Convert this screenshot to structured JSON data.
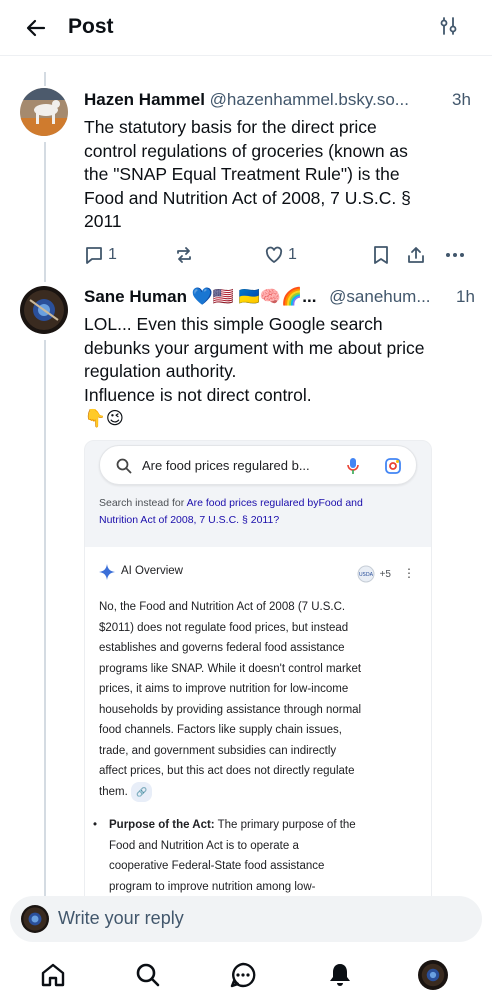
{
  "header": {
    "title": "Post",
    "back_icon": "arrow-left-icon",
    "sort_icon": "sliders-icon"
  },
  "post1": {
    "display_name": "Hazen Hammel",
    "handle": "@hazenhammel.bsky.so...",
    "time": "3h",
    "text_lines": [
      "The statutory basis for the direct price",
      "control regulations of groceries (known as",
      "the \"SNAP Equal Treatment Rule\") is the",
      "Food and Nutrition Act of 2008, 7 U.S.C. §",
      "2011"
    ],
    "reply_count": "1",
    "repost_count": "",
    "like_count": "1"
  },
  "post2": {
    "display_name": "Sane Human 💙🇺🇸 🇺🇦🧠🌈...",
    "handle": "@sanehum...",
    "time": "1h",
    "text_lines": [
      "LOL... Even this simple Google search",
      "debunks your argument with me about  price",
      "regulation authority.",
      "Influence is not direct control.",
      "👇😉"
    ]
  },
  "embed": {
    "search_query": "Are  food prices regulared b...",
    "search_instead_prefix": "Search instead for ",
    "search_instead_link_1": "Are food prices regulared byFood and",
    "search_instead_link_2": "Nutrition Act of 2008, 7 U.S.C. § 2011?",
    "ai_title": "AI Overview",
    "sources_count": "+5",
    "ai_body_lines": [
      "No, the Food and Nutrition Act of 2008 (7 U.S.C.",
      "$2011) does not regulate food prices, but instead",
      "establishes and governs federal food assistance",
      "programs like SNAP. While it doesn't control market",
      "prices, it aims to improve nutrition for low-income",
      "households by providing assistance through normal",
      "food channels. Factors like supply chain issues,",
      "trade, and government subsidies can indirectly",
      "affect prices, but this act does not directly regulate",
      "them."
    ],
    "bullet_bold": "Purpose of the Act:",
    "bullet_lines": [
      " The primary purpose of the",
      "Food and Nutrition Act is to operate a",
      "cooperative Federal-State food assistance",
      "program to improve nutrition among low-"
    ]
  },
  "reply": {
    "placeholder": "Write your reply"
  },
  "nav": {
    "items": [
      "home-icon",
      "search-icon",
      "chat-icon",
      "bell-icon",
      "profile-avatar"
    ]
  },
  "colors": {
    "muted": "#42576c",
    "thread_line": "#d4dbe2",
    "link": "#1a0dab"
  }
}
